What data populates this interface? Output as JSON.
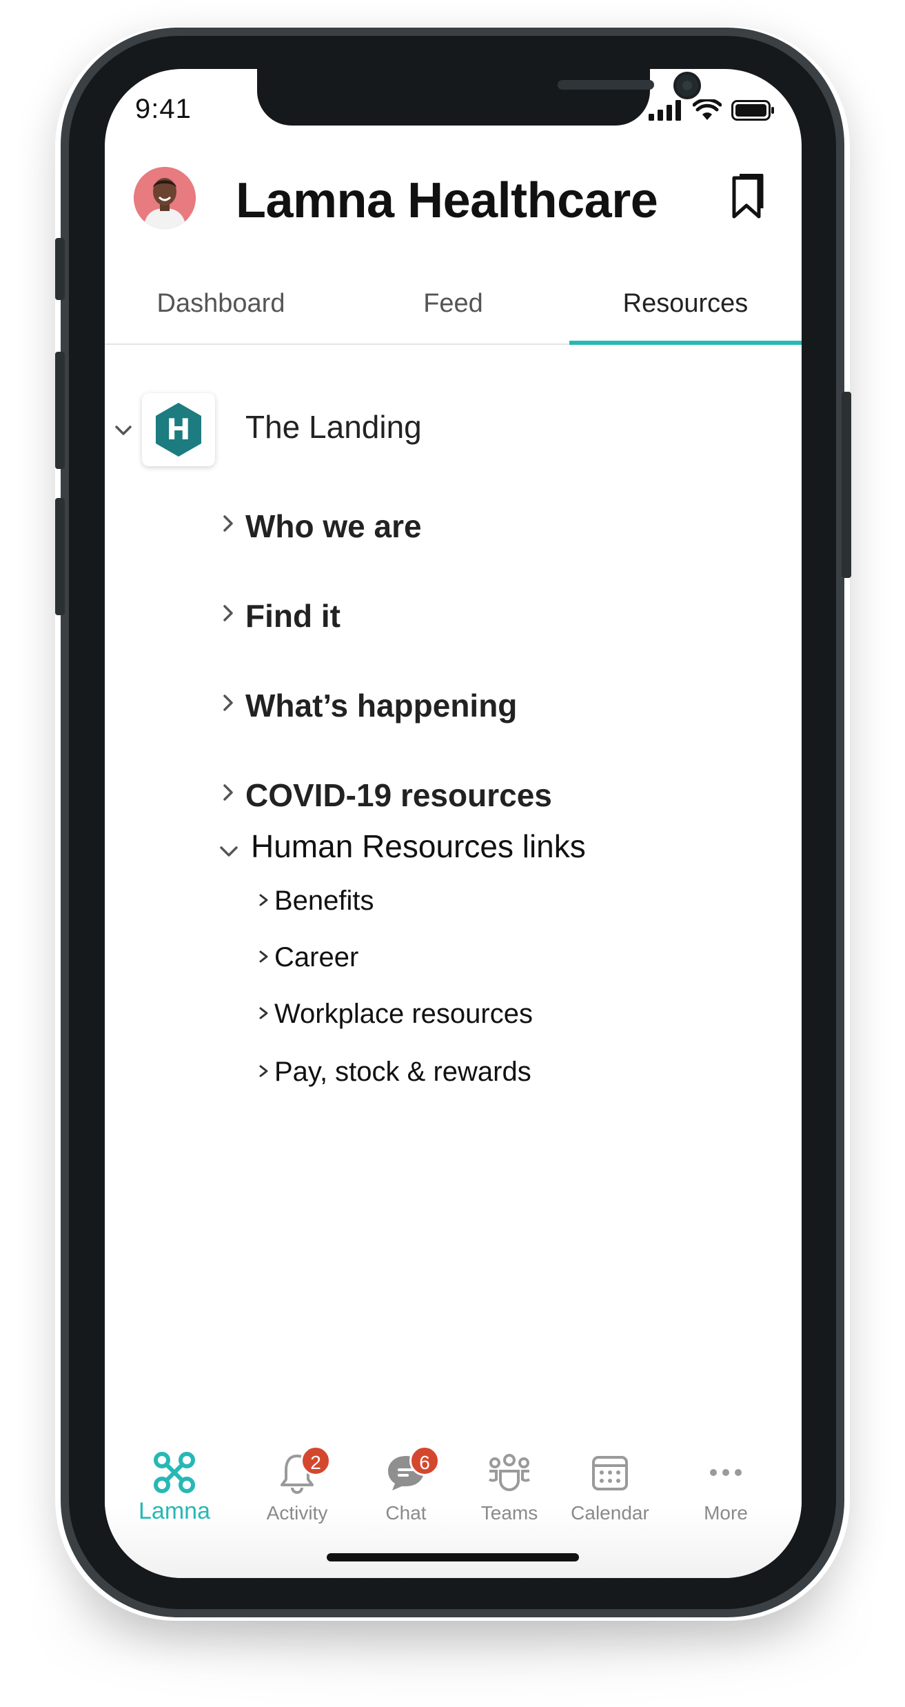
{
  "status_bar": {
    "time": "9:41"
  },
  "header": {
    "title": "Lamna Healthcare"
  },
  "tabs": [
    {
      "label": "Dashboard"
    },
    {
      "label": "Feed"
    },
    {
      "label": "Resources",
      "active": true
    }
  ],
  "tree": {
    "root": {
      "label": "The Landing",
      "logo_letter": "H",
      "expanded": true
    },
    "sections": [
      {
        "label": "Who we are",
        "expanded": false
      },
      {
        "label": "Find it",
        "expanded": false
      },
      {
        "label": "What’s happening",
        "expanded": false
      },
      {
        "label": "COVID-19 resources",
        "expanded": false
      }
    ],
    "hr": {
      "label": "Human Resources links",
      "expanded": true,
      "items": [
        {
          "label": "Benefits"
        },
        {
          "label": "Career"
        },
        {
          "label": "Workplace resources"
        },
        {
          "label": "Pay, stock & rewards"
        }
      ]
    }
  },
  "bottom_nav": [
    {
      "label": "Lamna",
      "icon": "lamna-app-icon",
      "active": true
    },
    {
      "label": "Activity",
      "icon": "bell-icon",
      "badge": "2"
    },
    {
      "label": "Chat",
      "icon": "chat-icon",
      "badge": "6"
    },
    {
      "label": "Teams",
      "icon": "teams-icon"
    },
    {
      "label": "Calendar",
      "icon": "calendar-icon"
    },
    {
      "label": "More",
      "icon": "more-icon"
    }
  ],
  "colors": {
    "accent": "#27b8b5",
    "badge": "#d4472e",
    "logo": "#1c7c80"
  }
}
